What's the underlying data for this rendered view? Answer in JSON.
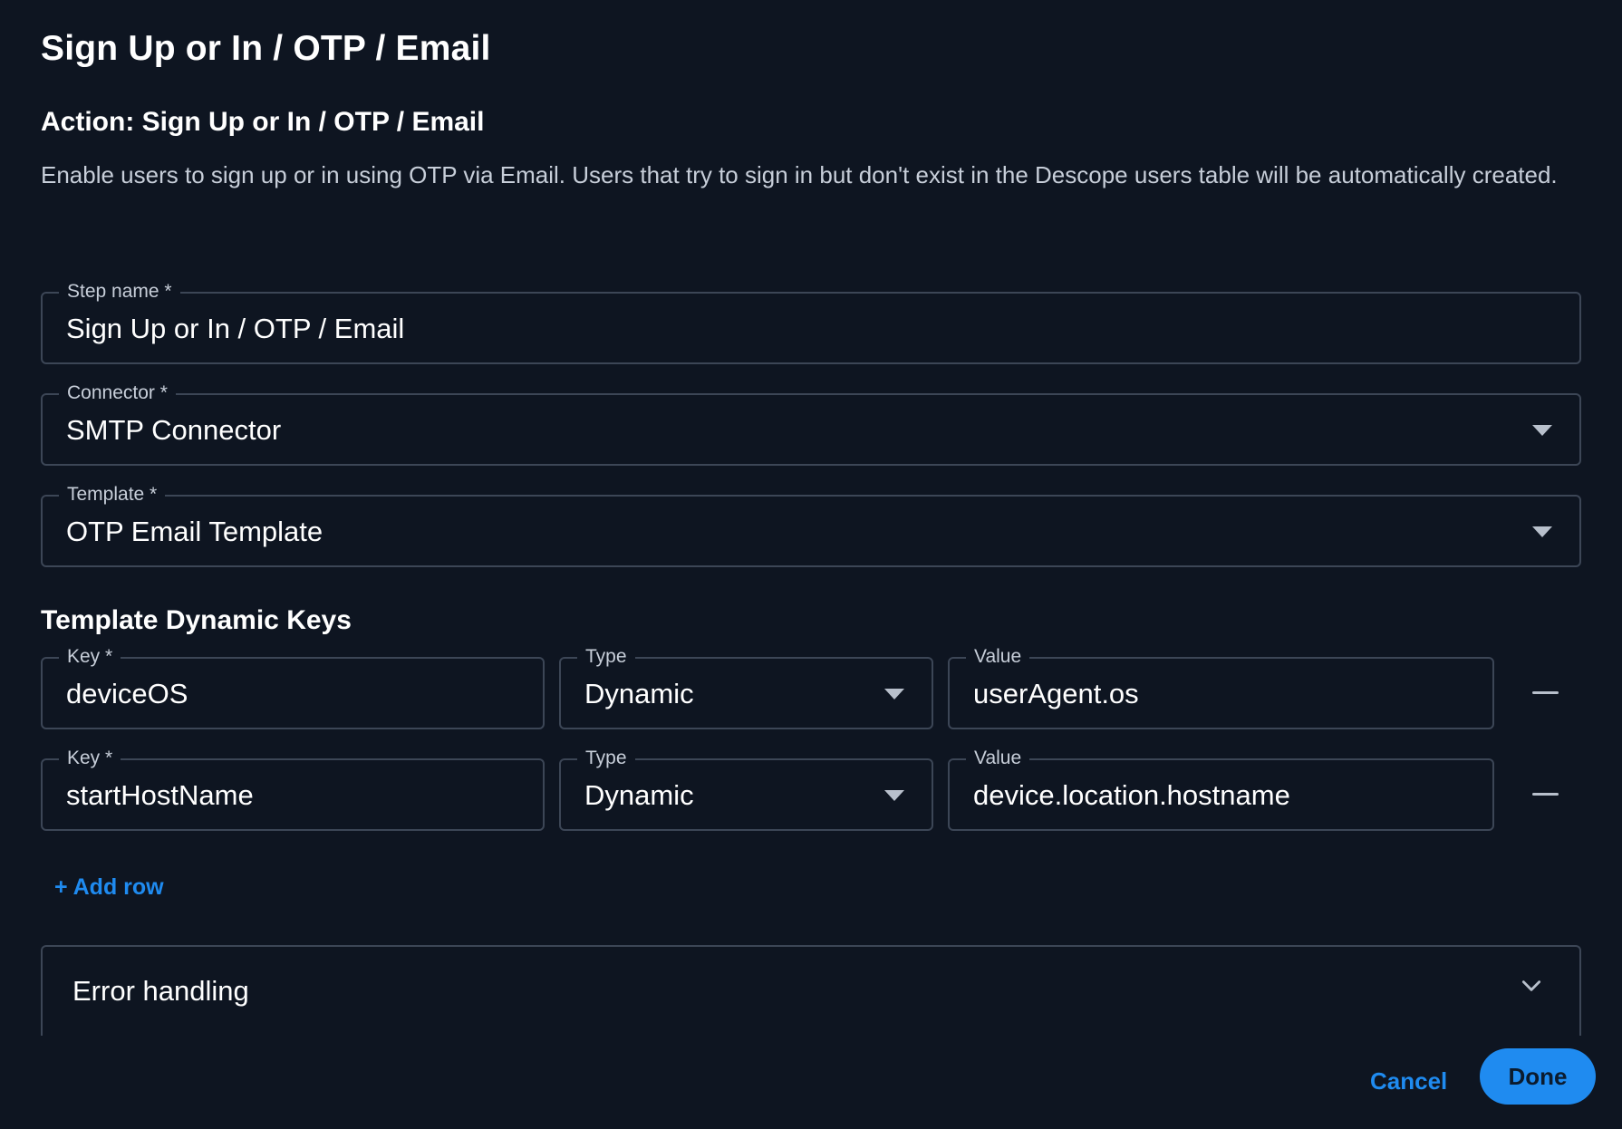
{
  "dialog": {
    "title": "Sign Up or In / OTP / Email",
    "action_title": "Action: Sign Up or In / OTP / Email",
    "description": "Enable users to sign up or in using OTP via Email. Users that try to sign in but don't exist in the Descope users table will be automatically created."
  },
  "fields": {
    "step_name": {
      "label": "Step name *",
      "value": "Sign Up or In / OTP / Email"
    },
    "connector": {
      "label": "Connector *",
      "value": "SMTP Connector"
    },
    "template": {
      "label": "Template *",
      "value": "OTP Email Template"
    }
  },
  "dynamic_keys": {
    "title": "Template Dynamic Keys",
    "rows": [
      {
        "key_label": "Key *",
        "key_value": "deviceOS",
        "type_label": "Type",
        "type_value": "Dynamic",
        "value_label": "Value",
        "value_value": "userAgent.os"
      },
      {
        "key_label": "Key *",
        "key_value": "startHostName",
        "type_label": "Type",
        "type_value": "Dynamic",
        "value_label": "Value",
        "value_value": "device.location.hostname"
      }
    ],
    "add_row_label": "+ Add row"
  },
  "error_handling": {
    "label": "Error handling"
  },
  "footer": {
    "cancel_label": "Cancel",
    "done_label": "Done"
  },
  "colors": {
    "background": "#0e1521",
    "accent": "#1f8bf0",
    "border": "#3c4656"
  },
  "icons": {
    "select_caret": "caret-down-icon",
    "remove_row": "minus-icon",
    "accordion": "chevron-down-icon"
  }
}
